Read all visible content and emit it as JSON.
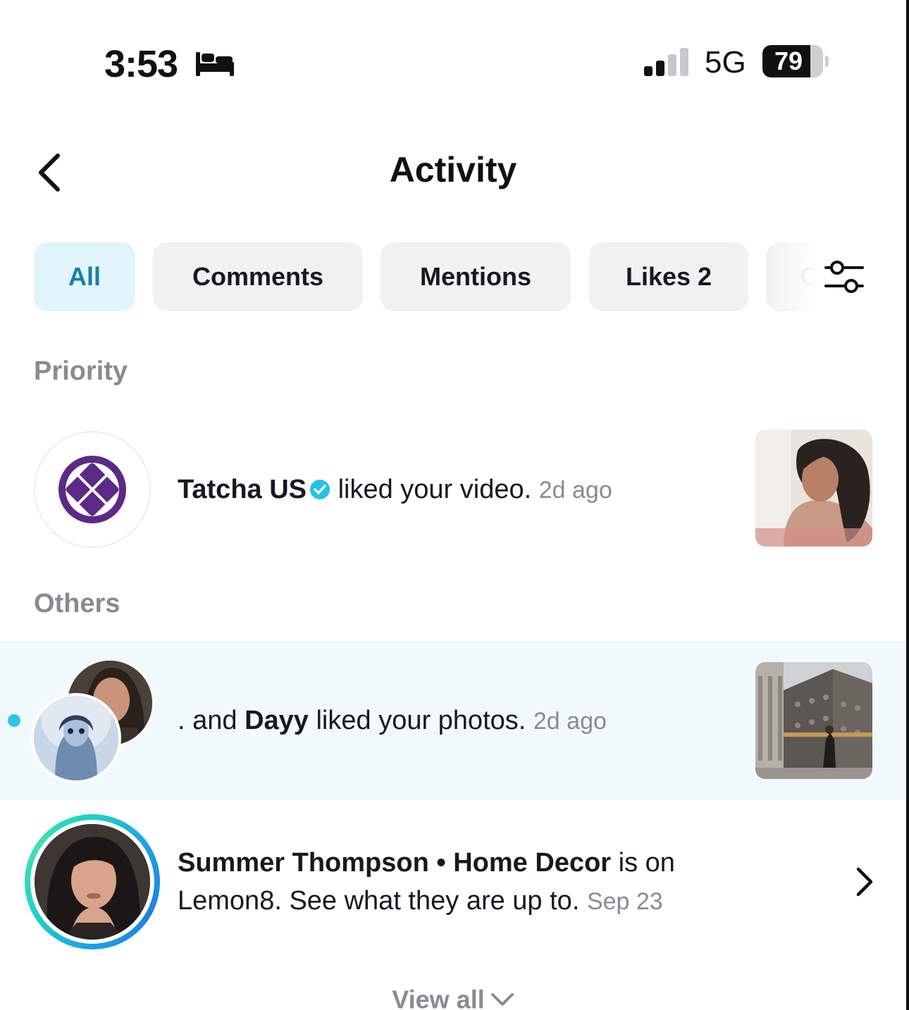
{
  "status_bar": {
    "time": "3:53",
    "network": "5G",
    "battery": "79",
    "battery_level": 0.79
  },
  "header": {
    "title": "Activity"
  },
  "tabs": [
    {
      "label": "All",
      "active": true
    },
    {
      "label": "Comments",
      "active": false
    },
    {
      "label": "Mentions",
      "active": false
    },
    {
      "label": "Likes 2",
      "active": false
    },
    {
      "label": "C",
      "active": false
    }
  ],
  "sections": {
    "priority": "Priority",
    "others": "Others"
  },
  "notifications": {
    "priority": [
      {
        "user": "Tatcha US",
        "action": " liked your video.",
        "time": "2d ago",
        "verified": true
      }
    ],
    "others": [
      {
        "prefix": ". and ",
        "user": "Dayy",
        "action": " liked your photos.",
        "time": "2d ago",
        "unread": true
      },
      {
        "user": "Summer Thompson • Home Decor",
        "action_line1": " is on",
        "action_line2": "Lemon8. See what they are up to.",
        "time": "Sep 23"
      }
    ]
  },
  "footer": {
    "view_all": "View all"
  },
  "colors": {
    "accent": "#2fc4e5",
    "active_tab_bg": "#e2f4fb",
    "active_tab_text": "#1a7fa6",
    "tatcha_purple": "#5b2a86",
    "muted_text": "#8a8b91"
  }
}
